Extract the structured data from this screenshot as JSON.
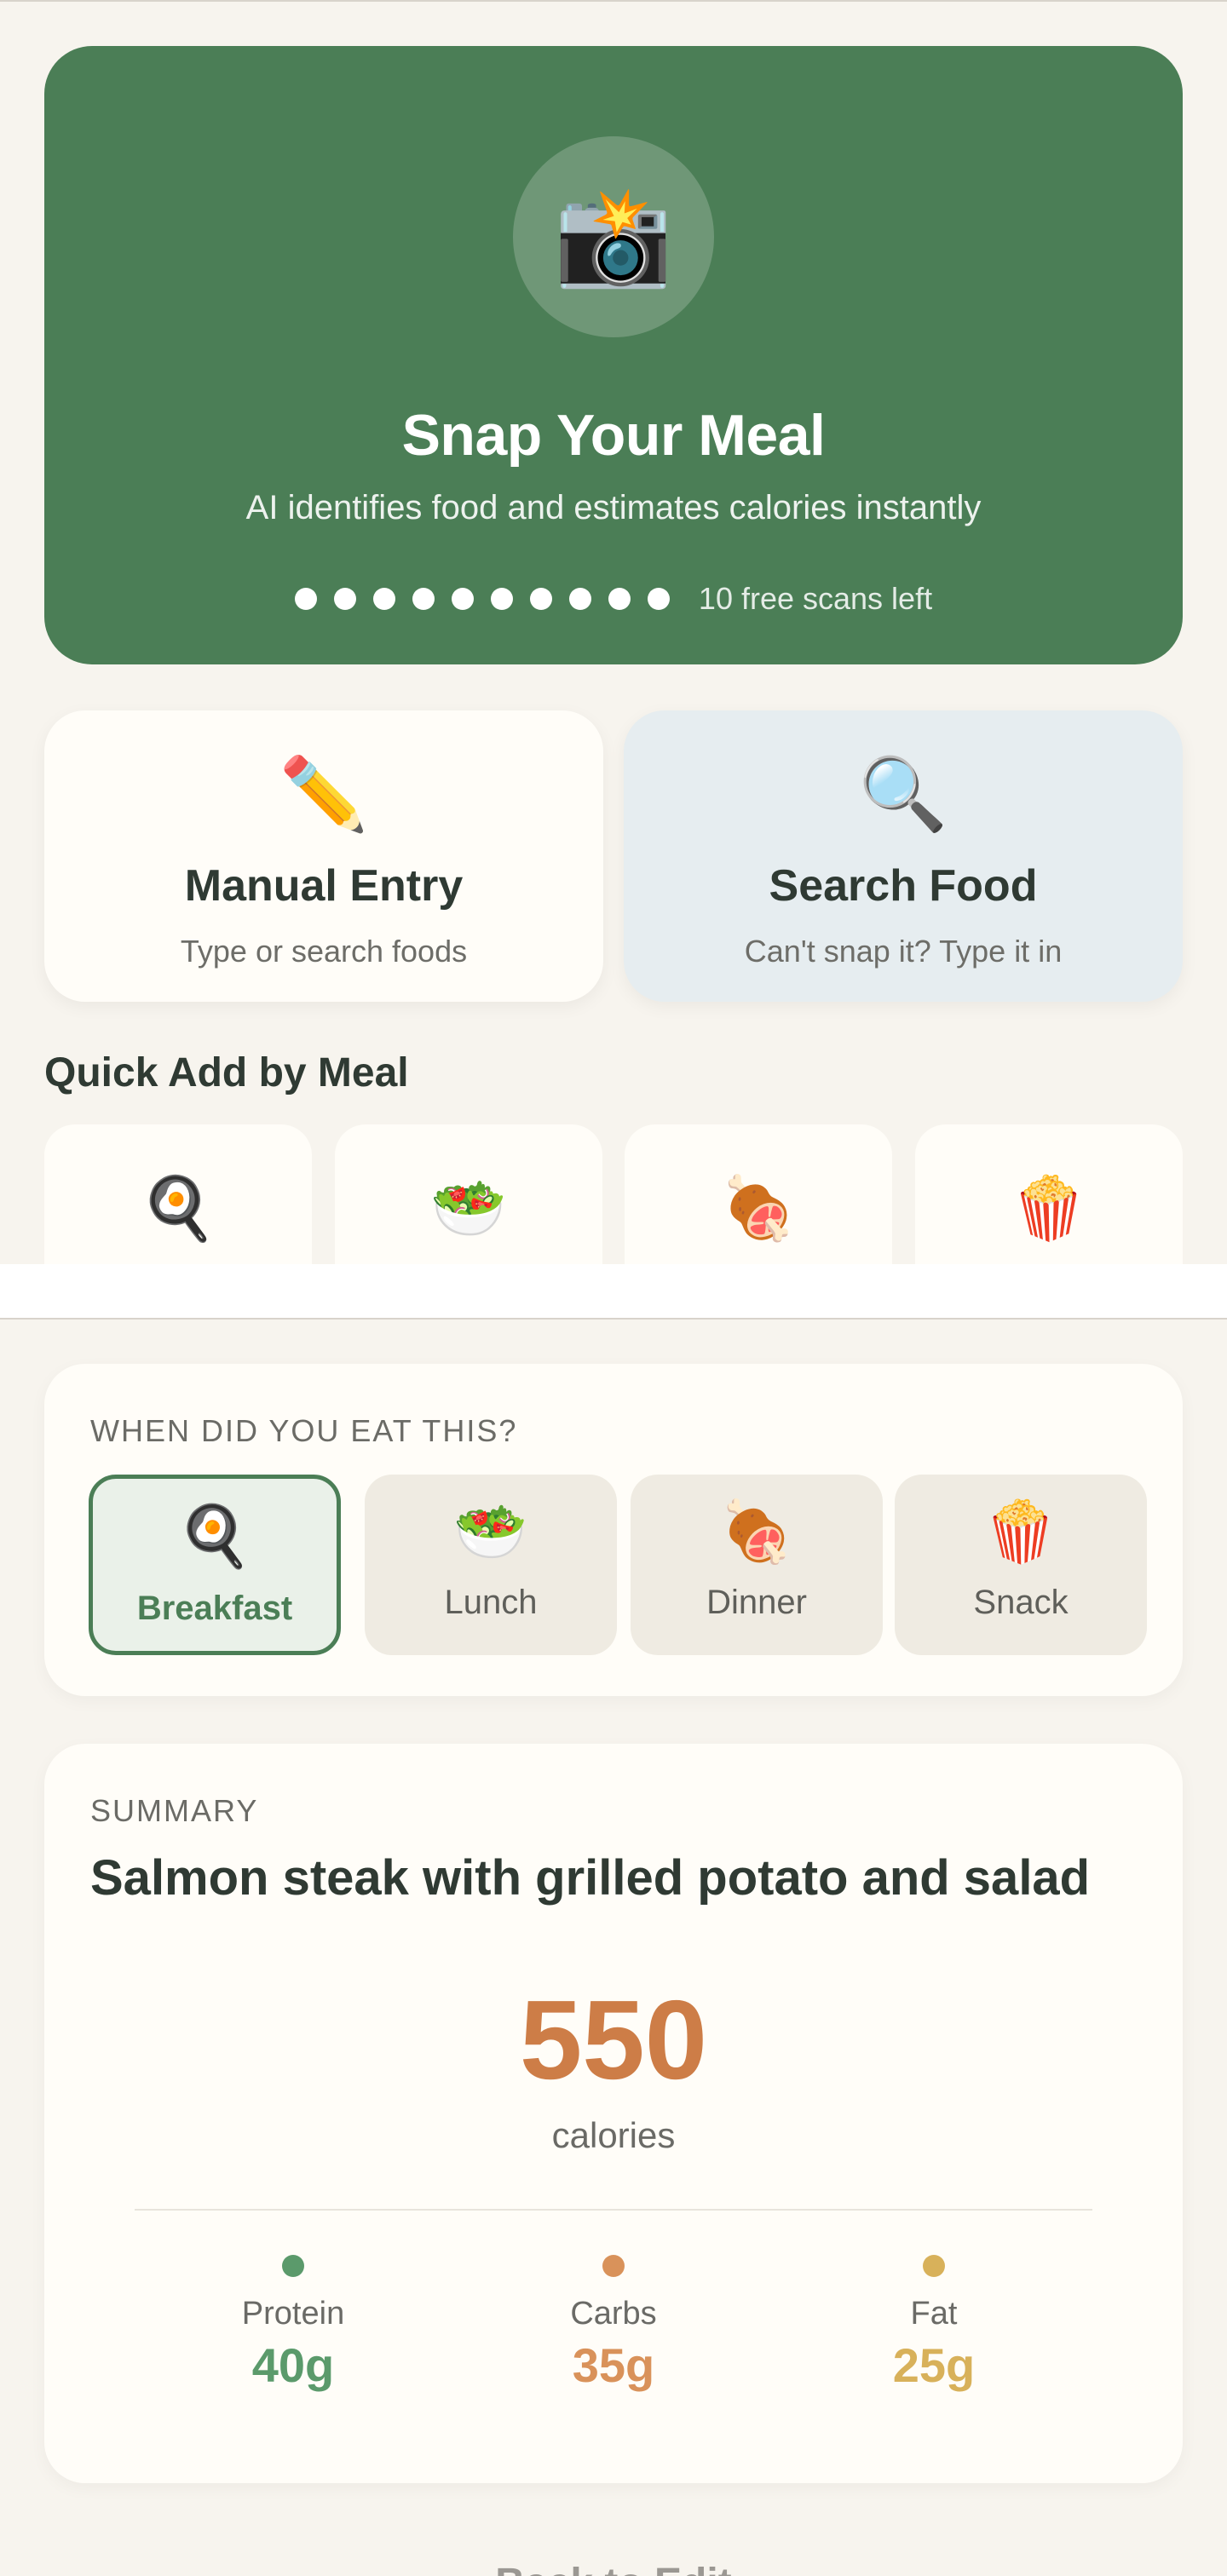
{
  "hero": {
    "icon": "📸",
    "icon_name": "camera-flash-icon",
    "title": "Snap Your Meal",
    "subtitle": "AI identifies food and estimates calories instantly",
    "scans_total_dots": 10,
    "scans_left_text": "10 free scans left",
    "color": "#4b7e56"
  },
  "actions": [
    {
      "icon": "✏️",
      "icon_name": "pencil-icon",
      "title": "Manual Entry",
      "subtitle": "Type or search foods"
    },
    {
      "icon": "🔍",
      "icon_name": "magnifier-icon",
      "title": "Search Food",
      "subtitle": "Can't snap it? Type it in"
    }
  ],
  "quick_add": {
    "title": "Quick Add by Meal",
    "items": [
      {
        "icon": "🍳",
        "icon_name": "frying-pan-icon"
      },
      {
        "icon": "🥗",
        "icon_name": "salad-icon"
      },
      {
        "icon": "🍖",
        "icon_name": "meat-icon"
      },
      {
        "icon": "🍿",
        "icon_name": "popcorn-icon"
      }
    ]
  },
  "when": {
    "label": "WHEN DID YOU EAT THIS?",
    "selected": "Breakfast",
    "meals": [
      {
        "icon": "🍳",
        "label": "Breakfast"
      },
      {
        "icon": "🥗",
        "label": "Lunch"
      },
      {
        "icon": "🍖",
        "label": "Dinner"
      },
      {
        "icon": "🍿",
        "label": "Snack"
      }
    ]
  },
  "summary": {
    "label": "SUMMARY",
    "meal_name": "Salmon steak with grilled potato and salad",
    "calories": "550",
    "calories_unit": "calories",
    "macros": [
      {
        "label": "Protein",
        "value": "40g",
        "color": "#5b9a6b"
      },
      {
        "label": "Carbs",
        "value": "35g",
        "color": "#d9925a"
      },
      {
        "label": "Fat",
        "value": "25g",
        "color": "#d8b15a"
      }
    ]
  },
  "footer_peek": "Back to Edit"
}
